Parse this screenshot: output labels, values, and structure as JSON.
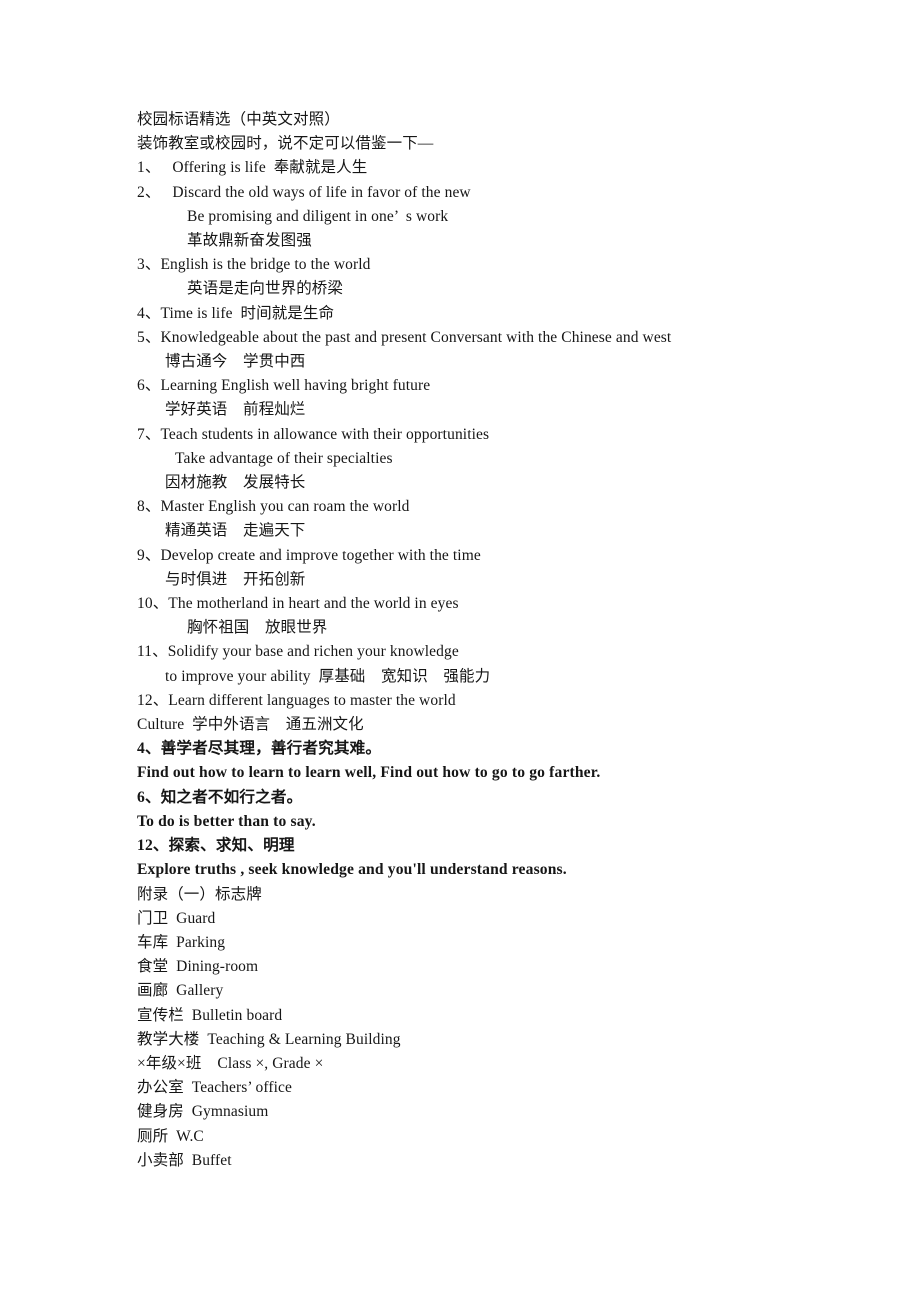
{
  "document": {
    "title": "校园标语精选（中英文对照）",
    "subtitle": "装饰教室或校园时，说不定可以借鉴一下—",
    "lines": [
      {
        "id": "title",
        "text": "校园标语精选（中英文对照）",
        "indent": 0,
        "bold": false
      },
      {
        "id": "intro",
        "text": "装饰教室或校园时，说不定可以借鉴一下—",
        "indent": 0,
        "bold": false
      },
      {
        "id": "item-1-en",
        "text": "1、   Offering is life  奉献就是人生",
        "indent": 0,
        "bold": false
      },
      {
        "id": "item-2-en",
        "text": "2、   Discard the old ways of life in favor of the new",
        "indent": 0,
        "bold": false
      },
      {
        "id": "item-2-en2",
        "text": "Be promising and diligent in one’  s work",
        "indent": 4,
        "bold": false
      },
      {
        "id": "item-2-cn",
        "text": "革故鼎新奋发图强",
        "indent": 4,
        "bold": false
      },
      {
        "id": "item-3-en",
        "text": "3、English is the bridge to the world",
        "indent": 0,
        "bold": false
      },
      {
        "id": "item-3-cn",
        "text": "英语是走向世界的桥梁",
        "indent": 4,
        "bold": false
      },
      {
        "id": "item-4-en",
        "text": "4、Time is life  时间就是生命",
        "indent": 0,
        "bold": false
      },
      {
        "id": "item-5-en",
        "text": "5、Knowledgeable about the past and present Conversant with the Chinese and west",
        "indent": 0,
        "bold": false
      },
      {
        "id": "item-5-cn",
        "text": "博古通今　学贯中西",
        "indent": 2,
        "bold": false
      },
      {
        "id": "item-6-en",
        "text": "6、Learning English well having bright future",
        "indent": 0,
        "bold": false
      },
      {
        "id": "item-6-cn",
        "text": "学好英语　前程灿烂",
        "indent": 2,
        "bold": false
      },
      {
        "id": "item-7-en",
        "text": "7、Teach students in allowance with their opportunities",
        "indent": 0,
        "bold": false
      },
      {
        "id": "item-7-en2",
        "text": "Take advantage of their specialties",
        "indent": 3,
        "bold": false
      },
      {
        "id": "item-7-cn",
        "text": "因材施教　发展特长",
        "indent": 2,
        "bold": false
      },
      {
        "id": "item-8-en",
        "text": "8、Master English you can roam the world",
        "indent": 0,
        "bold": false
      },
      {
        "id": "item-8-cn",
        "text": "精通英语　走遍天下",
        "indent": 2,
        "bold": false
      },
      {
        "id": "item-9-en",
        "text": "9、Develop create and improve together with the time",
        "indent": 0,
        "bold": false
      },
      {
        "id": "item-9-cn",
        "text": "与时俱进　开拓创新",
        "indent": 2,
        "bold": false
      },
      {
        "id": "item-10-en",
        "text": "10、The motherland in heart and the world in eyes",
        "indent": 0,
        "bold": false
      },
      {
        "id": "item-10-cn",
        "text": "胸怀祖国　放眼世界",
        "indent": 4,
        "bold": false
      },
      {
        "id": "item-11-en",
        "text": "11、Solidify your base and richen your knowledge",
        "indent": 0,
        "bold": false
      },
      {
        "id": "item-11-en2",
        "text": "to improve your ability  厚基础　宽知识　强能力",
        "indent": 2,
        "bold": false
      },
      {
        "id": "item-12-en",
        "text": "12、Learn different languages to master the world",
        "indent": 0,
        "bold": false
      },
      {
        "id": "item-12-cn",
        "text": "Culture  学中外语言　通五洲文化",
        "indent": 0,
        "bold": false
      },
      {
        "id": "bold-4-cn",
        "text": "4、善学者尽其理，善行者究其难。",
        "indent": 0,
        "bold": true
      },
      {
        "id": "bold-4-en",
        "text": "Find out how to learn to learn well, Find out how to go to go farther.",
        "indent": 0,
        "bold": true
      },
      {
        "id": "bold-6-cn",
        "text": "6、知之者不如行之者。",
        "indent": 0,
        "bold": true
      },
      {
        "id": "bold-6-en",
        "text": "To do is better than to say.",
        "indent": 0,
        "bold": true
      },
      {
        "id": "bold-12-cn",
        "text": "12、探索、求知、明理",
        "indent": 0,
        "bold": true
      },
      {
        "id": "bold-12-en",
        "text": "Explore truths , seek knowledge and you'll understand reasons.",
        "indent": 0,
        "bold": true
      },
      {
        "id": "appendix-title",
        "text": "附录（一）标志牌",
        "indent": 0,
        "bold": false
      },
      {
        "id": "sign-guard",
        "text": "门卫  Guard",
        "indent": 0,
        "bold": false
      },
      {
        "id": "sign-parking",
        "text": "车库  Parking",
        "indent": 0,
        "bold": false
      },
      {
        "id": "sign-dining",
        "text": "食堂  Dining-room",
        "indent": 0,
        "bold": false
      },
      {
        "id": "sign-gallery",
        "text": "画廊  Gallery",
        "indent": 0,
        "bold": false
      },
      {
        "id": "sign-bulletin",
        "text": "宣传栏  Bulletin board",
        "indent": 0,
        "bold": false
      },
      {
        "id": "sign-teaching",
        "text": "教学大楼  Teaching & Learning Building",
        "indent": 0,
        "bold": false
      },
      {
        "id": "sign-class",
        "text": "×年级×班    Class ×, Grade ×",
        "indent": 0,
        "bold": false
      },
      {
        "id": "sign-office",
        "text": "办公室  Teachers’ office",
        "indent": 0,
        "bold": false
      },
      {
        "id": "sign-gym",
        "text": "健身房  Gymnasium",
        "indent": 0,
        "bold": false
      },
      {
        "id": "sign-wc",
        "text": "厕所  W.C",
        "indent": 0,
        "bold": false
      },
      {
        "id": "sign-buffet",
        "text": "小卖部  Buffet",
        "indent": 0,
        "bold": false
      }
    ]
  },
  "colors": {
    "page_background": "#ffffff",
    "text": "#161616"
  }
}
